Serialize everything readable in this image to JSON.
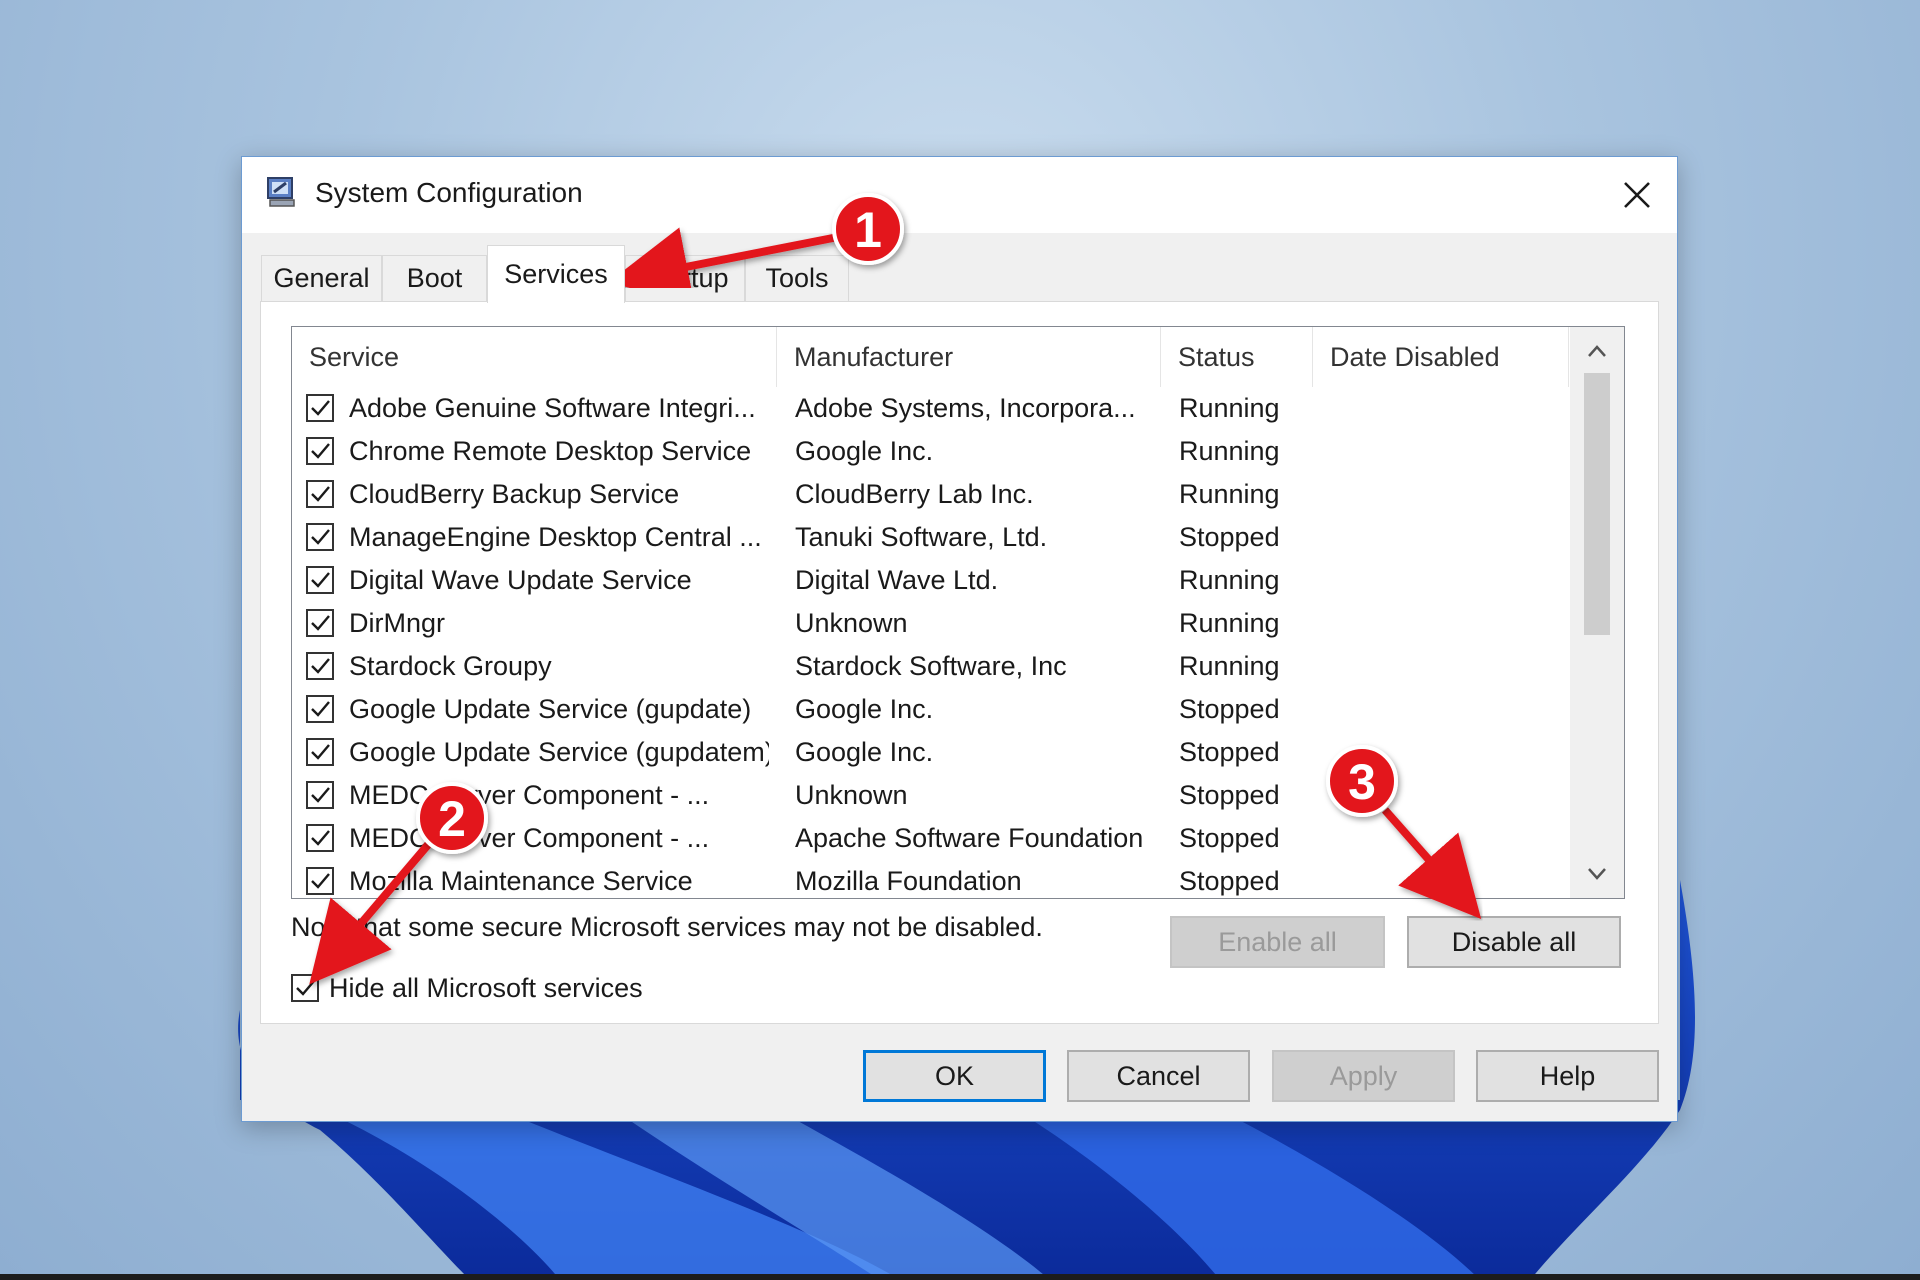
{
  "window": {
    "title": "System Configuration",
    "app_icon": "msconfig-icon",
    "close_icon": "close-icon"
  },
  "tabs": [
    {
      "label": "General",
      "active": false
    },
    {
      "label": "Boot",
      "active": false
    },
    {
      "label": "Services",
      "active": true
    },
    {
      "label": "Startup",
      "active": false
    },
    {
      "label": "Tools",
      "active": false
    }
  ],
  "services": {
    "columns": [
      "Service",
      "Manufacturer",
      "Status",
      "Date Disabled"
    ],
    "rows": [
      {
        "checked": true,
        "service": "Adobe Genuine Software Integri...",
        "manufacturer": "Adobe Systems, Incorpora...",
        "status": "Running",
        "date_disabled": ""
      },
      {
        "checked": true,
        "service": "Chrome Remote Desktop Service",
        "manufacturer": "Google Inc.",
        "status": "Running",
        "date_disabled": ""
      },
      {
        "checked": true,
        "service": "CloudBerry Backup Service",
        "manufacturer": "CloudBerry Lab Inc.",
        "status": "Running",
        "date_disabled": ""
      },
      {
        "checked": true,
        "service": "ManageEngine Desktop Central ...",
        "manufacturer": "Tanuki Software, Ltd.",
        "status": "Stopped",
        "date_disabled": ""
      },
      {
        "checked": true,
        "service": "Digital Wave Update Service",
        "manufacturer": "Digital Wave Ltd.",
        "status": "Running",
        "date_disabled": ""
      },
      {
        "checked": true,
        "service": "DirMngr",
        "manufacturer": "Unknown",
        "status": "Running",
        "date_disabled": ""
      },
      {
        "checked": true,
        "service": "Stardock Groupy",
        "manufacturer": "Stardock Software, Inc",
        "status": "Running",
        "date_disabled": ""
      },
      {
        "checked": true,
        "service": "Google Update Service (gupdate)",
        "manufacturer": "Google Inc.",
        "status": "Stopped",
        "date_disabled": ""
      },
      {
        "checked": true,
        "service": "Google Update Service (gupdatem)",
        "manufacturer": "Google Inc.",
        "status": "Stopped",
        "date_disabled": ""
      },
      {
        "checked": true,
        "service": "MEDC      Server Component - ...",
        "manufacturer": "Unknown",
        "status": "Stopped",
        "date_disabled": ""
      },
      {
        "checked": true,
        "service": "MEDC      Server Component - ...",
        "manufacturer": "Apache Software Foundation",
        "status": "Stopped",
        "date_disabled": ""
      },
      {
        "checked": true,
        "service": "Mozilla Maintenance Service",
        "manufacturer": "Mozilla Foundation",
        "status": "Stopped",
        "date_disabled": ""
      }
    ]
  },
  "note": "Note that some secure Microsoft services may not be disabled.",
  "enable_all": {
    "label": "Enable all",
    "enabled": false
  },
  "disable_all": {
    "label": "Disable all",
    "enabled": true
  },
  "hide_microsoft": {
    "label": "Hide all Microsoft services",
    "checked": true
  },
  "footer": {
    "ok": "OK",
    "cancel": "Cancel",
    "apply": "Apply",
    "help": "Help"
  },
  "annotations": {
    "color": "#e3131b",
    "badges": [
      "1",
      "2",
      "3"
    ]
  }
}
